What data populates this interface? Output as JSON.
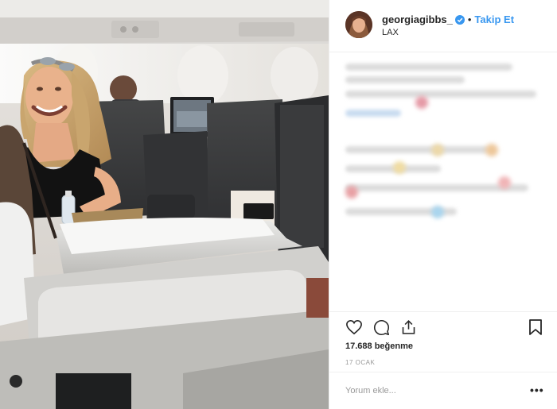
{
  "post": {
    "username": "georgiagibbs_",
    "separator": "•",
    "follow_label": "Takip Et",
    "location": "LAX",
    "likes_text": "17.688 beğenme",
    "date": "17 OCAK",
    "comment_placeholder": "Yorum ekle...",
    "more_label": "•••"
  },
  "icons": [
    "heart-icon",
    "comment-icon",
    "share-icon",
    "bookmark-icon",
    "verified-badge-icon"
  ],
  "colors": {
    "accent": "#3897f0",
    "text": "#262626",
    "muted": "#999999",
    "border": "#efefef"
  }
}
